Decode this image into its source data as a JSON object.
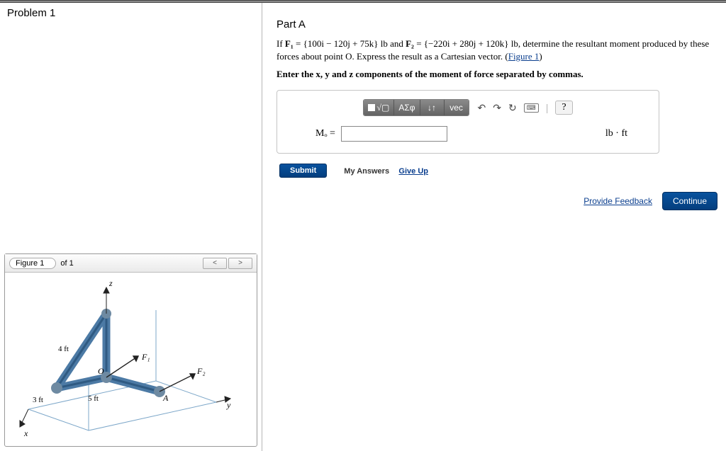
{
  "problem": {
    "title": "Problem 1"
  },
  "figure": {
    "selector": "Figure 1",
    "count_label": "of 1",
    "labels": {
      "z": "z",
      "y": "y",
      "x": "x",
      "O": "O",
      "A": "A",
      "F1": "F₁",
      "F2": "F₂",
      "d4ft": "4 ft",
      "d5ft": "5 ft",
      "d3ft": "3 ft"
    }
  },
  "part": {
    "title": "Part A",
    "prompt_prefix": "If ",
    "F1_label": "F₁",
    "F1_expr": " = {100i − 120j + 75k} lb",
    "and": " and ",
    "F2_label": "F₂",
    "F2_expr": " = {−220i + 280j + 120k} lb",
    "prompt_rest": ", determine the resultant moment produced by these forces about point O. Express the result as a Cartesian vector. (",
    "figure_link": "Figure 1",
    "prompt_close": ")",
    "prompt_bold": "Enter the x, y and z components of the moment of force separated by commas."
  },
  "toolbar": {
    "template": "▢√▢",
    "greek": "ΑΣφ",
    "arrows": "↓↑",
    "vec": "vec",
    "undo": "↶",
    "redo": "↷",
    "reset": "↻",
    "keyboard": "⌨",
    "help": "?"
  },
  "answer": {
    "lhs": "Mₒ =",
    "value": "",
    "units": "lb · ft"
  },
  "submit": {
    "submit_label": "Submit",
    "myanswers_label": "My Answers",
    "giveup_label": "Give Up"
  },
  "footer": {
    "feedback": "Provide Feedback",
    "continue": "Continue"
  }
}
